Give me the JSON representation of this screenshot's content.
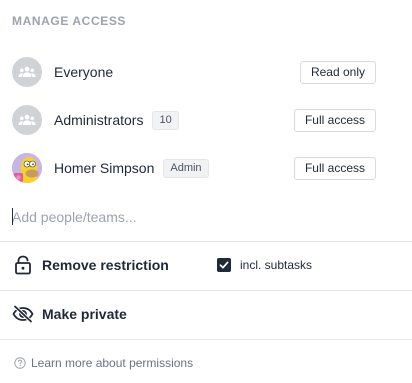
{
  "header": {
    "title": "MANAGE ACCESS"
  },
  "members": [
    {
      "name": "Everyone",
      "badge": "",
      "access": "Read only",
      "avatar_icon": "group-icon"
    },
    {
      "name": "Administrators",
      "badge": "10",
      "access": "Full access",
      "avatar_icon": "group-icon"
    },
    {
      "name": "Homer Simpson",
      "badge": "Admin",
      "access": "Full access",
      "avatar_icon": "user-avatar"
    }
  ],
  "add_people": {
    "placeholder": "Add people/teams..."
  },
  "restriction": {
    "label": "Remove restriction",
    "icon": "lock-open-icon"
  },
  "subtasks": {
    "label": "incl. subtasks",
    "checked": true
  },
  "private": {
    "label": "Make private",
    "icon": "eye-off-icon"
  },
  "footer": {
    "learn_more": "Learn more about permissions",
    "icon": "help-circle-icon"
  },
  "colors": {
    "checkbox": "#1f2a3a",
    "avatar_group": "#cfd2d6",
    "text_primary": "#1f2937",
    "muted": "#9ca3af"
  }
}
